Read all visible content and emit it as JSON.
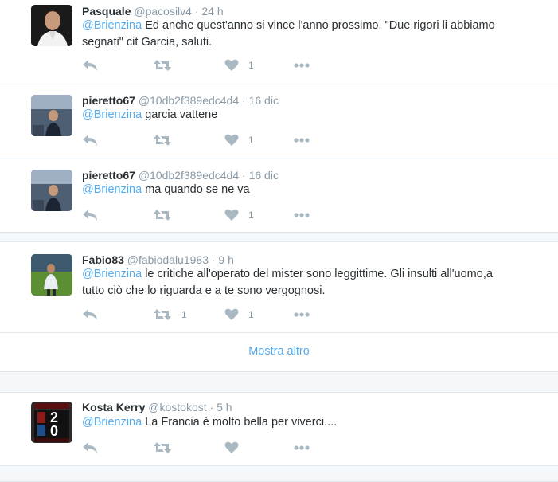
{
  "tweets": [
    {
      "name": "Pasquale",
      "handle": "@pacosilv4",
      "time": "· 24 h",
      "mention": "@Brienzina",
      "text_line1": " Ed anche quest'anno si vince l'anno prossimo. \"Due rigori li abbiamo",
      "text_line2": "segnati\" cit Garcia, saluti.",
      "retweets": "",
      "likes": "1"
    },
    {
      "name": "pieretto67",
      "handle": "@10db2f389edc4d4",
      "time": "· 16 dic",
      "mention": "@Brienzina",
      "text_line1": " garcia vattene",
      "retweets": "",
      "likes": "1"
    },
    {
      "name": "pieretto67",
      "handle": "@10db2f389edc4d4",
      "time": "· 16 dic",
      "mention": "@Brienzina",
      "text_line1": " ma quando se ne va",
      "retweets": "",
      "likes": "1"
    },
    {
      "name": "Fabio83",
      "handle": "@fabiodalu1983",
      "time": "· 9 h",
      "mention": "@Brienzina",
      "text_line1": " le critiche all'operato del mister sono leggittime. Gli insulti all'uomo,a",
      "text_line2": "tutto ciò che lo riguarda e a te sono vergognosi.",
      "retweets": "1",
      "likes": "1"
    },
    {
      "name": "Kosta Kerry",
      "handle": "@kostokost",
      "time": "· 5 h",
      "mention": "@Brienzina",
      "text_line1": " La Francia è molto bella per viverci....",
      "retweets": "",
      "likes": ""
    }
  ],
  "show_more_label": "Mostra altro",
  "scoreboard": {
    "top": "2",
    "bottom": "0"
  },
  "icons": [
    "reply-icon",
    "retweet-icon",
    "like-icon",
    "more-icon"
  ],
  "colors": {
    "mention": "#55acee",
    "icon": "#aab8c2",
    "meta": "#8899a6"
  }
}
